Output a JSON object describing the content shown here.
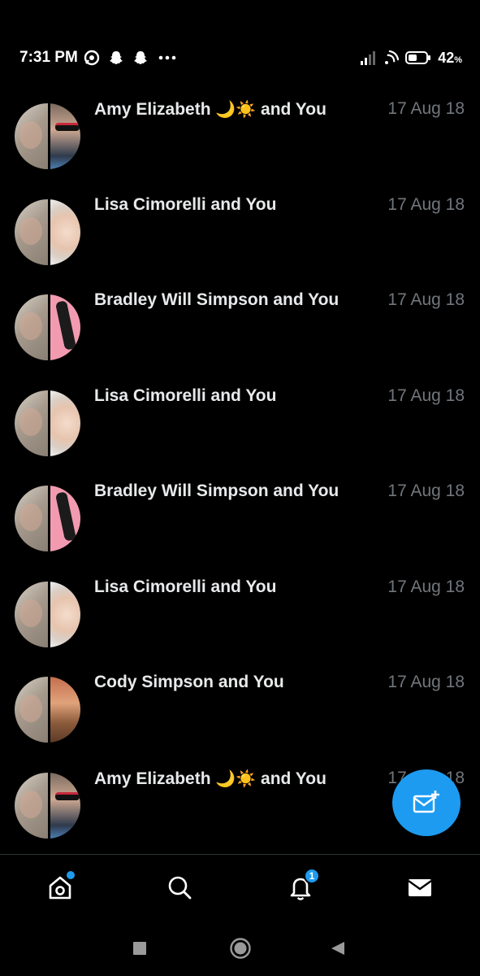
{
  "status_bar": {
    "time": "7:31 PM",
    "battery_percent": "42",
    "battery_suffix": "%",
    "left_icons": [
      "messenger-icon",
      "snapchat-icon",
      "snapchat-icon",
      "more-dots-icon"
    ],
    "right_icons": [
      "signal-icon",
      "wifi-icon",
      "battery-icon"
    ]
  },
  "conversations": [
    {
      "name": "Amy Elizabeth ",
      "emoji": "🌙☀️",
      "suffix": " and You",
      "date": "17 Aug 18",
      "avatar": "amy"
    },
    {
      "name": "Lisa Cimorelli and You",
      "emoji": "",
      "suffix": "",
      "date": "17 Aug 18",
      "avatar": "lisa"
    },
    {
      "name": "Bradley Will Simpson and You",
      "emoji": "",
      "suffix": "",
      "date": "17 Aug 18",
      "avatar": "bradley"
    },
    {
      "name": "Lisa Cimorelli and You",
      "emoji": "",
      "suffix": "",
      "date": "17 Aug 18",
      "avatar": "lisa"
    },
    {
      "name": "Bradley Will Simpson and You",
      "emoji": "",
      "suffix": "",
      "date": "17 Aug 18",
      "avatar": "bradley"
    },
    {
      "name": "Lisa Cimorelli and You",
      "emoji": "",
      "suffix": "",
      "date": "17 Aug 18",
      "avatar": "lisa"
    },
    {
      "name": "Cody Simpson and You",
      "emoji": "",
      "suffix": "",
      "date": "17 Aug 18",
      "avatar": "cody"
    },
    {
      "name": "Amy Elizabeth ",
      "emoji": "🌙☀️",
      "suffix": " and You",
      "date": "17 Aug 18",
      "avatar": "amy"
    }
  ],
  "fab": {
    "icon": "new-message-icon"
  },
  "bottom_nav": {
    "items": [
      {
        "icon": "home-icon",
        "has_dot": true
      },
      {
        "icon": "search-icon"
      },
      {
        "icon": "notifications-icon",
        "badge": "1"
      },
      {
        "icon": "messages-icon",
        "active": true
      }
    ]
  },
  "system_nav": {
    "icons": [
      "recents-icon",
      "home-button-icon",
      "back-icon"
    ]
  },
  "colors": {
    "accent": "#1d9bf0",
    "background": "#000000",
    "text": "#e7e9ea",
    "secondary_text": "#71767b"
  }
}
